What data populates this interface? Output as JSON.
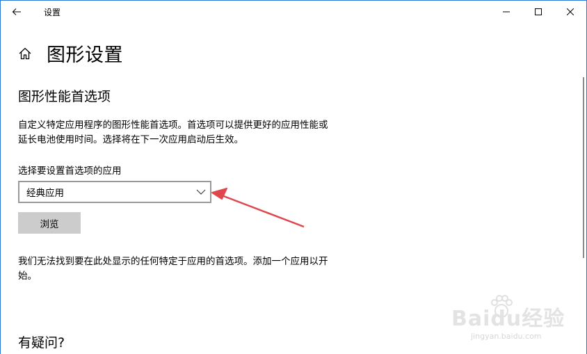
{
  "window": {
    "title": "设置"
  },
  "header": {
    "page_title": "图形设置"
  },
  "section": {
    "title": "图形性能首选项",
    "description": "自定义特定应用程序的图形性能首选项。首选项可以提供更好的应用性能或延长电池使用时间。选择将在下一次应用启动后生效。"
  },
  "app_picker": {
    "label": "选择要设置首选项的应用",
    "selected": "经典应用",
    "browse_label": "浏览"
  },
  "empty_state": {
    "message": "我们无法找到要在此处显示的任何特定于应用的首选项。添加一个应用以开始。"
  },
  "help": {
    "title": "有疑问?"
  },
  "watermark": {
    "brand": "Baidu经验",
    "url": "jingyan.baidu.com"
  },
  "colors": {
    "accent_border": "#2b79d6",
    "annotation_arrow": "#e0474c",
    "button_bg": "#cccccc"
  }
}
